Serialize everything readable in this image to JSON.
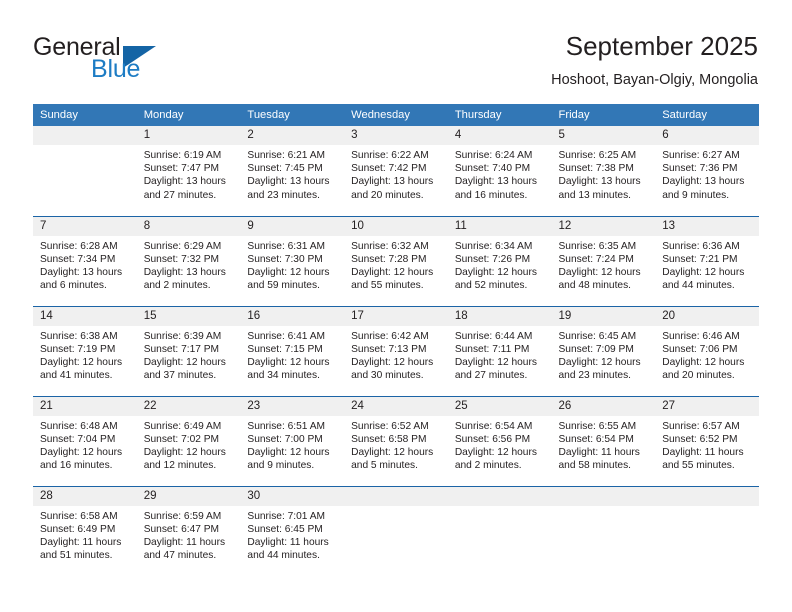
{
  "logo": {
    "word_one": "General",
    "word_two": "Blue",
    "triangle_color": "#1464a5",
    "blue_text_color": "#1d7cc4"
  },
  "header": {
    "title": "September 2025",
    "subtitle": "Hoshoot, Bayan-Olgiy, Mongolia"
  },
  "theme": {
    "header_blue": "#3277b6",
    "row_divider_blue": "#1b64a6",
    "daynum_background": "#f0f0f0",
    "text_color": "#231f20"
  },
  "calendar": {
    "weekday_headers": [
      "Sunday",
      "Monday",
      "Tuesday",
      "Wednesday",
      "Thursday",
      "Friday",
      "Saturday"
    ],
    "weeks": [
      [
        {
          "day": "",
          "sunrise": "",
          "sunset": "",
          "daylight_line1": "",
          "daylight_line2": ""
        },
        {
          "day": "1",
          "sunrise": "Sunrise: 6:19 AM",
          "sunset": "Sunset: 7:47 PM",
          "daylight_line1": "Daylight: 13 hours",
          "daylight_line2": "and 27 minutes."
        },
        {
          "day": "2",
          "sunrise": "Sunrise: 6:21 AM",
          "sunset": "Sunset: 7:45 PM",
          "daylight_line1": "Daylight: 13 hours",
          "daylight_line2": "and 23 minutes."
        },
        {
          "day": "3",
          "sunrise": "Sunrise: 6:22 AM",
          "sunset": "Sunset: 7:42 PM",
          "daylight_line1": "Daylight: 13 hours",
          "daylight_line2": "and 20 minutes."
        },
        {
          "day": "4",
          "sunrise": "Sunrise: 6:24 AM",
          "sunset": "Sunset: 7:40 PM",
          "daylight_line1": "Daylight: 13 hours",
          "daylight_line2": "and 16 minutes."
        },
        {
          "day": "5",
          "sunrise": "Sunrise: 6:25 AM",
          "sunset": "Sunset: 7:38 PM",
          "daylight_line1": "Daylight: 13 hours",
          "daylight_line2": "and 13 minutes."
        },
        {
          "day": "6",
          "sunrise": "Sunrise: 6:27 AM",
          "sunset": "Sunset: 7:36 PM",
          "daylight_line1": "Daylight: 13 hours",
          "daylight_line2": "and 9 minutes."
        }
      ],
      [
        {
          "day": "7",
          "sunrise": "Sunrise: 6:28 AM",
          "sunset": "Sunset: 7:34 PM",
          "daylight_line1": "Daylight: 13 hours",
          "daylight_line2": "and 6 minutes."
        },
        {
          "day": "8",
          "sunrise": "Sunrise: 6:29 AM",
          "sunset": "Sunset: 7:32 PM",
          "daylight_line1": "Daylight: 13 hours",
          "daylight_line2": "and 2 minutes."
        },
        {
          "day": "9",
          "sunrise": "Sunrise: 6:31 AM",
          "sunset": "Sunset: 7:30 PM",
          "daylight_line1": "Daylight: 12 hours",
          "daylight_line2": "and 59 minutes."
        },
        {
          "day": "10",
          "sunrise": "Sunrise: 6:32 AM",
          "sunset": "Sunset: 7:28 PM",
          "daylight_line1": "Daylight: 12 hours",
          "daylight_line2": "and 55 minutes."
        },
        {
          "day": "11",
          "sunrise": "Sunrise: 6:34 AM",
          "sunset": "Sunset: 7:26 PM",
          "daylight_line1": "Daylight: 12 hours",
          "daylight_line2": "and 52 minutes."
        },
        {
          "day": "12",
          "sunrise": "Sunrise: 6:35 AM",
          "sunset": "Sunset: 7:24 PM",
          "daylight_line1": "Daylight: 12 hours",
          "daylight_line2": "and 48 minutes."
        },
        {
          "day": "13",
          "sunrise": "Sunrise: 6:36 AM",
          "sunset": "Sunset: 7:21 PM",
          "daylight_line1": "Daylight: 12 hours",
          "daylight_line2": "and 44 minutes."
        }
      ],
      [
        {
          "day": "14",
          "sunrise": "Sunrise: 6:38 AM",
          "sunset": "Sunset: 7:19 PM",
          "daylight_line1": "Daylight: 12 hours",
          "daylight_line2": "and 41 minutes."
        },
        {
          "day": "15",
          "sunrise": "Sunrise: 6:39 AM",
          "sunset": "Sunset: 7:17 PM",
          "daylight_line1": "Daylight: 12 hours",
          "daylight_line2": "and 37 minutes."
        },
        {
          "day": "16",
          "sunrise": "Sunrise: 6:41 AM",
          "sunset": "Sunset: 7:15 PM",
          "daylight_line1": "Daylight: 12 hours",
          "daylight_line2": "and 34 minutes."
        },
        {
          "day": "17",
          "sunrise": "Sunrise: 6:42 AM",
          "sunset": "Sunset: 7:13 PM",
          "daylight_line1": "Daylight: 12 hours",
          "daylight_line2": "and 30 minutes."
        },
        {
          "day": "18",
          "sunrise": "Sunrise: 6:44 AM",
          "sunset": "Sunset: 7:11 PM",
          "daylight_line1": "Daylight: 12 hours",
          "daylight_line2": "and 27 minutes."
        },
        {
          "day": "19",
          "sunrise": "Sunrise: 6:45 AM",
          "sunset": "Sunset: 7:09 PM",
          "daylight_line1": "Daylight: 12 hours",
          "daylight_line2": "and 23 minutes."
        },
        {
          "day": "20",
          "sunrise": "Sunrise: 6:46 AM",
          "sunset": "Sunset: 7:06 PM",
          "daylight_line1": "Daylight: 12 hours",
          "daylight_line2": "and 20 minutes."
        }
      ],
      [
        {
          "day": "21",
          "sunrise": "Sunrise: 6:48 AM",
          "sunset": "Sunset: 7:04 PM",
          "daylight_line1": "Daylight: 12 hours",
          "daylight_line2": "and 16 minutes."
        },
        {
          "day": "22",
          "sunrise": "Sunrise: 6:49 AM",
          "sunset": "Sunset: 7:02 PM",
          "daylight_line1": "Daylight: 12 hours",
          "daylight_line2": "and 12 minutes."
        },
        {
          "day": "23",
          "sunrise": "Sunrise: 6:51 AM",
          "sunset": "Sunset: 7:00 PM",
          "daylight_line1": "Daylight: 12 hours",
          "daylight_line2": "and 9 minutes."
        },
        {
          "day": "24",
          "sunrise": "Sunrise: 6:52 AM",
          "sunset": "Sunset: 6:58 PM",
          "daylight_line1": "Daylight: 12 hours",
          "daylight_line2": "and 5 minutes."
        },
        {
          "day": "25",
          "sunrise": "Sunrise: 6:54 AM",
          "sunset": "Sunset: 6:56 PM",
          "daylight_line1": "Daylight: 12 hours",
          "daylight_line2": "and 2 minutes."
        },
        {
          "day": "26",
          "sunrise": "Sunrise: 6:55 AM",
          "sunset": "Sunset: 6:54 PM",
          "daylight_line1": "Daylight: 11 hours",
          "daylight_line2": "and 58 minutes."
        },
        {
          "day": "27",
          "sunrise": "Sunrise: 6:57 AM",
          "sunset": "Sunset: 6:52 PM",
          "daylight_line1": "Daylight: 11 hours",
          "daylight_line2": "and 55 minutes."
        }
      ],
      [
        {
          "day": "28",
          "sunrise": "Sunrise: 6:58 AM",
          "sunset": "Sunset: 6:49 PM",
          "daylight_line1": "Daylight: 11 hours",
          "daylight_line2": "and 51 minutes."
        },
        {
          "day": "29",
          "sunrise": "Sunrise: 6:59 AM",
          "sunset": "Sunset: 6:47 PM",
          "daylight_line1": "Daylight: 11 hours",
          "daylight_line2": "and 47 minutes."
        },
        {
          "day": "30",
          "sunrise": "Sunrise: 7:01 AM",
          "sunset": "Sunset: 6:45 PM",
          "daylight_line1": "Daylight: 11 hours",
          "daylight_line2": "and 44 minutes."
        },
        {
          "day": "",
          "sunrise": "",
          "sunset": "",
          "daylight_line1": "",
          "daylight_line2": ""
        },
        {
          "day": "",
          "sunrise": "",
          "sunset": "",
          "daylight_line1": "",
          "daylight_line2": ""
        },
        {
          "day": "",
          "sunrise": "",
          "sunset": "",
          "daylight_line1": "",
          "daylight_line2": ""
        },
        {
          "day": "",
          "sunrise": "",
          "sunset": "",
          "daylight_line1": "",
          "daylight_line2": ""
        }
      ]
    ]
  }
}
